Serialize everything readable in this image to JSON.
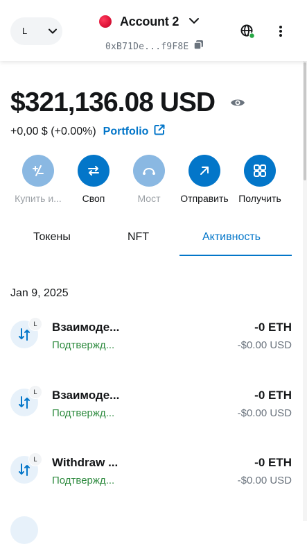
{
  "header": {
    "network_label": "L",
    "account_name": "Account 2",
    "address": "0xB71De...f9F8E"
  },
  "balance": {
    "amount": "$321,136.08 USD",
    "change": "+0,00 $ (+0.00%)",
    "portfolio_label": "Portfolio"
  },
  "actions": [
    {
      "label": "Купить и...",
      "icon": "buy-sell-icon",
      "state": "disabled"
    },
    {
      "label": "Своп",
      "icon": "swap-icon",
      "state": "active"
    },
    {
      "label": "Мост",
      "icon": "bridge-icon",
      "state": "disabled"
    },
    {
      "label": "Отправить",
      "icon": "send-icon",
      "state": "active"
    },
    {
      "label": "Получить",
      "icon": "receive-icon",
      "state": "active"
    }
  ],
  "tabs": [
    {
      "label": "Токены"
    },
    {
      "label": "NFT"
    },
    {
      "label": "Активность",
      "active": true
    }
  ],
  "activity": {
    "date": "Jan 9, 2025",
    "items": [
      {
        "badge": "L",
        "title": "Взаимоде...",
        "status": "Подтвержд...",
        "amount": "-0 ETH",
        "fiat": "-$0.00 USD"
      },
      {
        "badge": "L",
        "title": "Взаимоде...",
        "status": "Подтвержд...",
        "amount": "-0 ETH",
        "fiat": "-$0.00 USD"
      },
      {
        "badge": "L",
        "title": "Withdraw ...",
        "status": "Подтвержд...",
        "amount": "-0 ETH",
        "fiat": "-$0.00 USD"
      }
    ]
  },
  "colors": {
    "accent": "#0376c9",
    "accent_disabled": "#8ab8e2",
    "success": "#2d8a3e",
    "muted": "#6a737d"
  }
}
